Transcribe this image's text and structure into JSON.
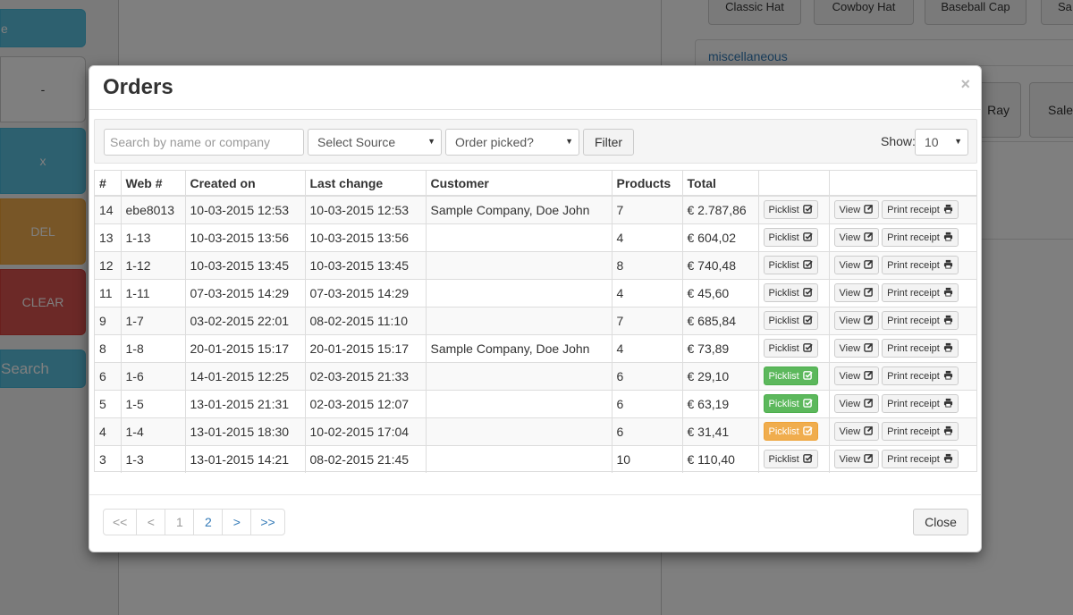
{
  "background": {
    "keypad": [
      "e",
      "-",
      "x",
      "DEL",
      "CLEAR",
      "Search"
    ],
    "hats": [
      "Classic Hat",
      "Cowboy Hat",
      "Baseball Cap",
      "Sa"
    ],
    "category_label": "miscellaneous",
    "tiles": [
      "Ray",
      "Sale"
    ]
  },
  "modal": {
    "title": "Orders",
    "close_symbol": "×",
    "filters": {
      "search_placeholder": "Search by name or company",
      "source_label": "Select Source",
      "picked_label": "Order picked?",
      "filter_button": "Filter",
      "show_label": "Show:",
      "show_value": "10"
    },
    "table": {
      "headers": [
        "#",
        "Web #",
        "Created on",
        "Last change",
        "Customer",
        "Products",
        "Total",
        "",
        ""
      ],
      "picklist_label": "Picklist",
      "view_label": "View",
      "print_label": "Print receipt",
      "rows": [
        {
          "id": "14",
          "web": "ebe8013",
          "created": "10-03-2015 12:53",
          "changed": "10-03-2015 12:53",
          "customer": "Sample Company, Doe John",
          "products": "7",
          "total": "€ 2.787,86",
          "picklist": "default"
        },
        {
          "id": "13",
          "web": "1-13",
          "created": "10-03-2015 13:56",
          "changed": "10-03-2015 13:56",
          "customer": "",
          "products": "4",
          "total": "€ 604,02",
          "picklist": "default"
        },
        {
          "id": "12",
          "web": "1-12",
          "created": "10-03-2015 13:45",
          "changed": "10-03-2015 13:45",
          "customer": "",
          "products": "8",
          "total": "€ 740,48",
          "picklist": "default"
        },
        {
          "id": "11",
          "web": "1-11",
          "created": "07-03-2015 14:29",
          "changed": "07-03-2015 14:29",
          "customer": "",
          "products": "4",
          "total": "€ 45,60",
          "picklist": "default"
        },
        {
          "id": "9",
          "web": "1-7",
          "created": "03-02-2015 22:01",
          "changed": "08-02-2015 11:10",
          "customer": "",
          "products": "7",
          "total": "€ 685,84",
          "picklist": "default"
        },
        {
          "id": "8",
          "web": "1-8",
          "created": "20-01-2015 15:17",
          "changed": "20-01-2015 15:17",
          "customer": "Sample Company, Doe John",
          "products": "4",
          "total": "€ 73,89",
          "picklist": "default"
        },
        {
          "id": "6",
          "web": "1-6",
          "created": "14-01-2015 12:25",
          "changed": "02-03-2015 21:33",
          "customer": "",
          "products": "6",
          "total": "€ 29,10",
          "picklist": "success"
        },
        {
          "id": "5",
          "web": "1-5",
          "created": "13-01-2015 21:31",
          "changed": "02-03-2015 12:07",
          "customer": "",
          "products": "6",
          "total": "€ 63,19",
          "picklist": "success"
        },
        {
          "id": "4",
          "web": "1-4",
          "created": "13-01-2015 18:30",
          "changed": "10-02-2015 17:04",
          "customer": "",
          "products": "6",
          "total": "€ 31,41",
          "picklist": "warning"
        },
        {
          "id": "3",
          "web": "1-3",
          "created": "13-01-2015 14:21",
          "changed": "08-02-2015 21:45",
          "customer": "",
          "products": "10",
          "total": "€ 110,40",
          "picklist": "default"
        }
      ]
    },
    "pagination": [
      {
        "label": "<<",
        "state": "disabled"
      },
      {
        "label": "<",
        "state": "disabled"
      },
      {
        "label": "1",
        "state": "current"
      },
      {
        "label": "2",
        "state": "link"
      },
      {
        "label": ">",
        "state": "link"
      },
      {
        "label": ">>",
        "state": "link"
      }
    ],
    "close_button": "Close"
  },
  "colors": {
    "success": "#5cb85c",
    "warning": "#f0ad4e",
    "info": "#5bc0de",
    "danger": "#d9534f",
    "link": "#337ab7"
  },
  "icons": {
    "picklist": "check-square-icon",
    "view": "edit-icon",
    "print": "printer-icon"
  }
}
